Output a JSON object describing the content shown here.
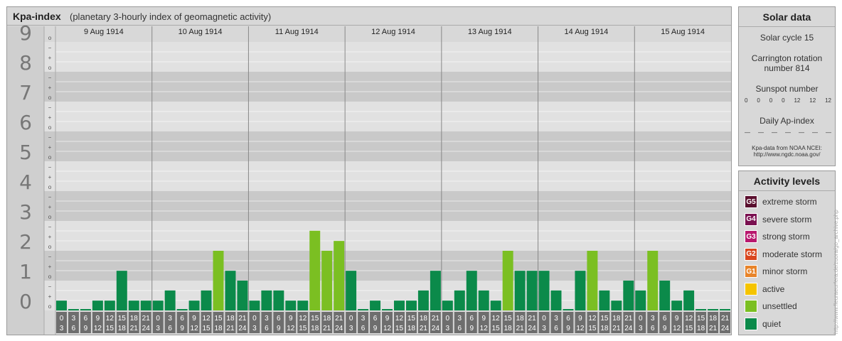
{
  "header": {
    "title": "Kpa-index",
    "subtitle": "(planetary 3-hourly index of geomagnetic activity)"
  },
  "chart_data": {
    "type": "bar",
    "ylim": [
      0,
      9
    ],
    "y_ticks": [
      "0",
      "1",
      "2",
      "3",
      "4",
      "5",
      "6",
      "7",
      "8",
      "9"
    ],
    "sub_tick_labels": [
      "+",
      "o",
      "−"
    ],
    "days": [
      "9 Aug 1914",
      "10 Aug 1914",
      "11 Aug 1914",
      "12 Aug 1914",
      "13 Aug 1914",
      "14 Aug 1914",
      "15 Aug 1914"
    ],
    "interval_labels": [
      [
        "0",
        "3"
      ],
      [
        "3",
        "6"
      ],
      [
        "6",
        "9"
      ],
      [
        "9",
        "12"
      ],
      [
        "12",
        "15"
      ],
      [
        "15",
        "18"
      ],
      [
        "18",
        "21"
      ],
      [
        "21",
        "24"
      ]
    ],
    "values": [
      0.33,
      0,
      0,
      0.33,
      0.33,
      1.33,
      0.33,
      0.33,
      0.33,
      0.67,
      0,
      0.33,
      0.67,
      2,
      1.33,
      1,
      0.33,
      0.67,
      0.67,
      0.33,
      0.33,
      2.67,
      2,
      2.33,
      1.33,
      0,
      0.33,
      0,
      0.33,
      0.33,
      0.67,
      1.33,
      0.33,
      0.67,
      1.33,
      0.67,
      0.33,
      2,
      1.33,
      1.33,
      1.33,
      0.67,
      0,
      1.33,
      2,
      0.67,
      0.33,
      1,
      0.67,
      2,
      1,
      0.33,
      0.67,
      0,
      0,
      0
    ],
    "colors": {
      "quiet": "#0b8a4a",
      "unsettled": "#7bbf22"
    }
  },
  "solar": {
    "title": "Solar data",
    "cycle": "Solar cycle 15",
    "carrington_line1": "Carrington rotation",
    "carrington_line2": "number 814",
    "sunspot_label": "Sunspot number",
    "sunspot_values": [
      "0",
      "0",
      "0",
      "0",
      "12",
      "12",
      "12"
    ],
    "ap_label": "Daily Ap-index",
    "ap_values": [
      "—",
      "—",
      "—",
      "—",
      "—",
      "—",
      "—"
    ],
    "source_line1": "Kpa-data from NOAA NCEI:",
    "source_line2": "http://www.ngdc.noaa.gov/"
  },
  "activity": {
    "title": "Activity levels",
    "items": [
      {
        "code": "G5",
        "label": "extreme storm",
        "color": "#5a0f2e"
      },
      {
        "code": "G4",
        "label": "severe storm",
        "color": "#7a1050"
      },
      {
        "code": "G3",
        "label": "strong storm",
        "color": "#b8186e"
      },
      {
        "code": "G2",
        "label": "moderate storm",
        "color": "#d9461f"
      },
      {
        "code": "G1",
        "label": "minor storm",
        "color": "#e8842a"
      },
      {
        "code": "",
        "label": "active",
        "color": "#f5c400"
      },
      {
        "code": "",
        "label": "unsettled",
        "color": "#7bbf22"
      },
      {
        "code": "",
        "label": "quiet",
        "color": "#0b8a4a"
      }
    ]
  },
  "credit": "http://www.fleuraeurfera.de/zuora/go_archive.php"
}
